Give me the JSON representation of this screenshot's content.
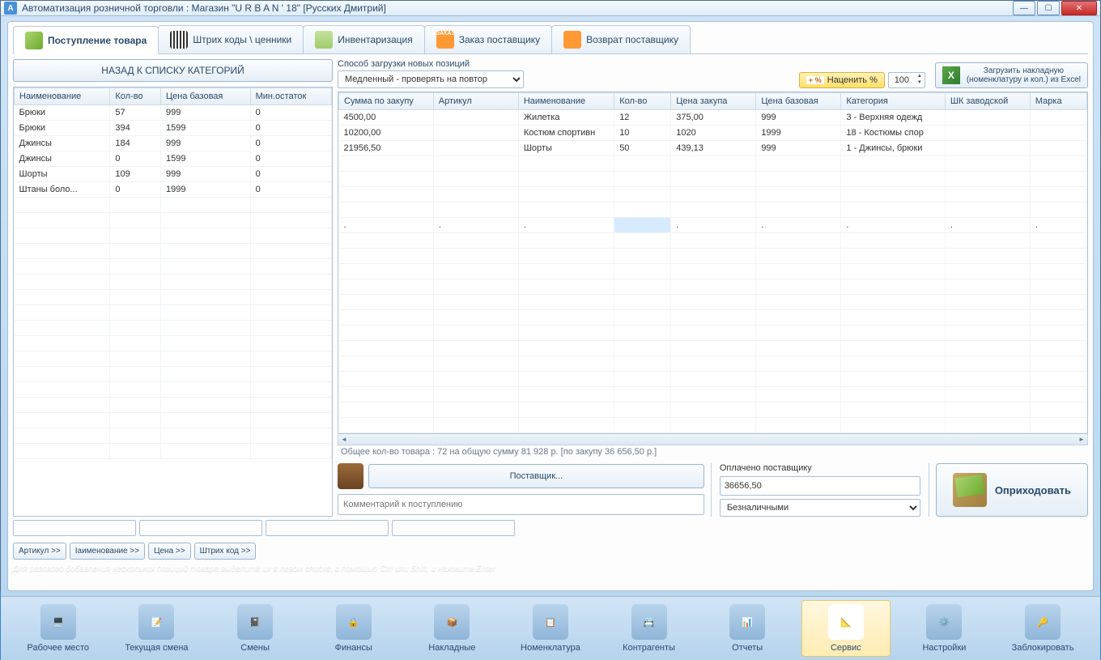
{
  "title": "Автоматизация розничной торговли : Магазин \"U R B A N ' 18\" [Русских Дмитрий]",
  "tabs": [
    {
      "label": "Поступление товара"
    },
    {
      "label": "Штрих коды \\ ценники"
    },
    {
      "label": "Инвентаризация"
    },
    {
      "label": "Заказ поставщику",
      "badge": "ЗАКАЗ"
    },
    {
      "label": "Возврат поставщику"
    }
  ],
  "back_btn": "НАЗАД К СПИСКУ КАТЕГОРИЙ",
  "left_headers": [
    "Наименование",
    "Кол-во",
    "Цена базовая",
    "Мин.остаток"
  ],
  "left_rows": [
    [
      "Брюки",
      "57",
      "999",
      "0"
    ],
    [
      "Брюки",
      "394",
      "1599",
      "0"
    ],
    [
      "Джинсы",
      "184",
      "999",
      "0"
    ],
    [
      "Джинсы",
      "0",
      "1599",
      "0"
    ],
    [
      "Шорты",
      "109",
      "999",
      "0"
    ],
    [
      "Штаны боло...",
      "0",
      "1999",
      "0"
    ]
  ],
  "load_mode_label": "Способ загрузки новых позиций",
  "load_mode_value": "Медленный - проверять на повтор",
  "markup_btn": "Наценить %",
  "markup_value": "100",
  "load_invoice_l1": "Загрузить накладную",
  "load_invoice_l2": "(номенклатуру и кол.) из Excel",
  "right_headers": [
    "Сумма по закупу",
    "Артикул",
    "Наименование",
    "Кол-во",
    "Цена закупа",
    "Цена базовая",
    "Категория",
    "ШК заводской",
    "Марка"
  ],
  "right_rows": [
    [
      "4500,00",
      "",
      "Жилетка",
      "12",
      "375,00",
      "999",
      "3 - Верхняя одежд",
      "",
      ""
    ],
    [
      "10200,00",
      "",
      "Костюм спортивн",
      "10",
      "1020",
      "1999",
      "18 - Костюмы спор",
      "",
      ""
    ],
    [
      "21956,50",
      "",
      "Шорты",
      "50",
      "439,13",
      "999",
      "1 - Джинсы, брюки",
      "",
      ""
    ]
  ],
  "summary": "Общее кол-во товара : 72 на общую сумму 81 928 р. [по закупу 36 656,50 р.]",
  "art_btns": [
    "Артикул >>",
    "Іаименование >>",
    "Цена >>",
    "Штрих код >>"
  ],
  "hint": "Для разового добавления нескольких позиций товара выделите их в левом списке, с помощью Ctrl или Shift, и нажмите Enter",
  "supplier_btn": "Поставщик...",
  "comment_placeholder": "Комментарий к поступлению",
  "paid_label": "Оплачено поставщику",
  "paid_value": "36656,50",
  "pay_method": "Безналичными",
  "action_btn": "Оприходовать",
  "nav": [
    "Рабочее место",
    "Текущая смена",
    "Смены",
    "Финансы",
    "Накладные",
    "Номенклатура",
    "Контрагенты",
    "Отчеты",
    "Сервис",
    "Настройки",
    "Заблокировать"
  ],
  "nav_active": 8
}
